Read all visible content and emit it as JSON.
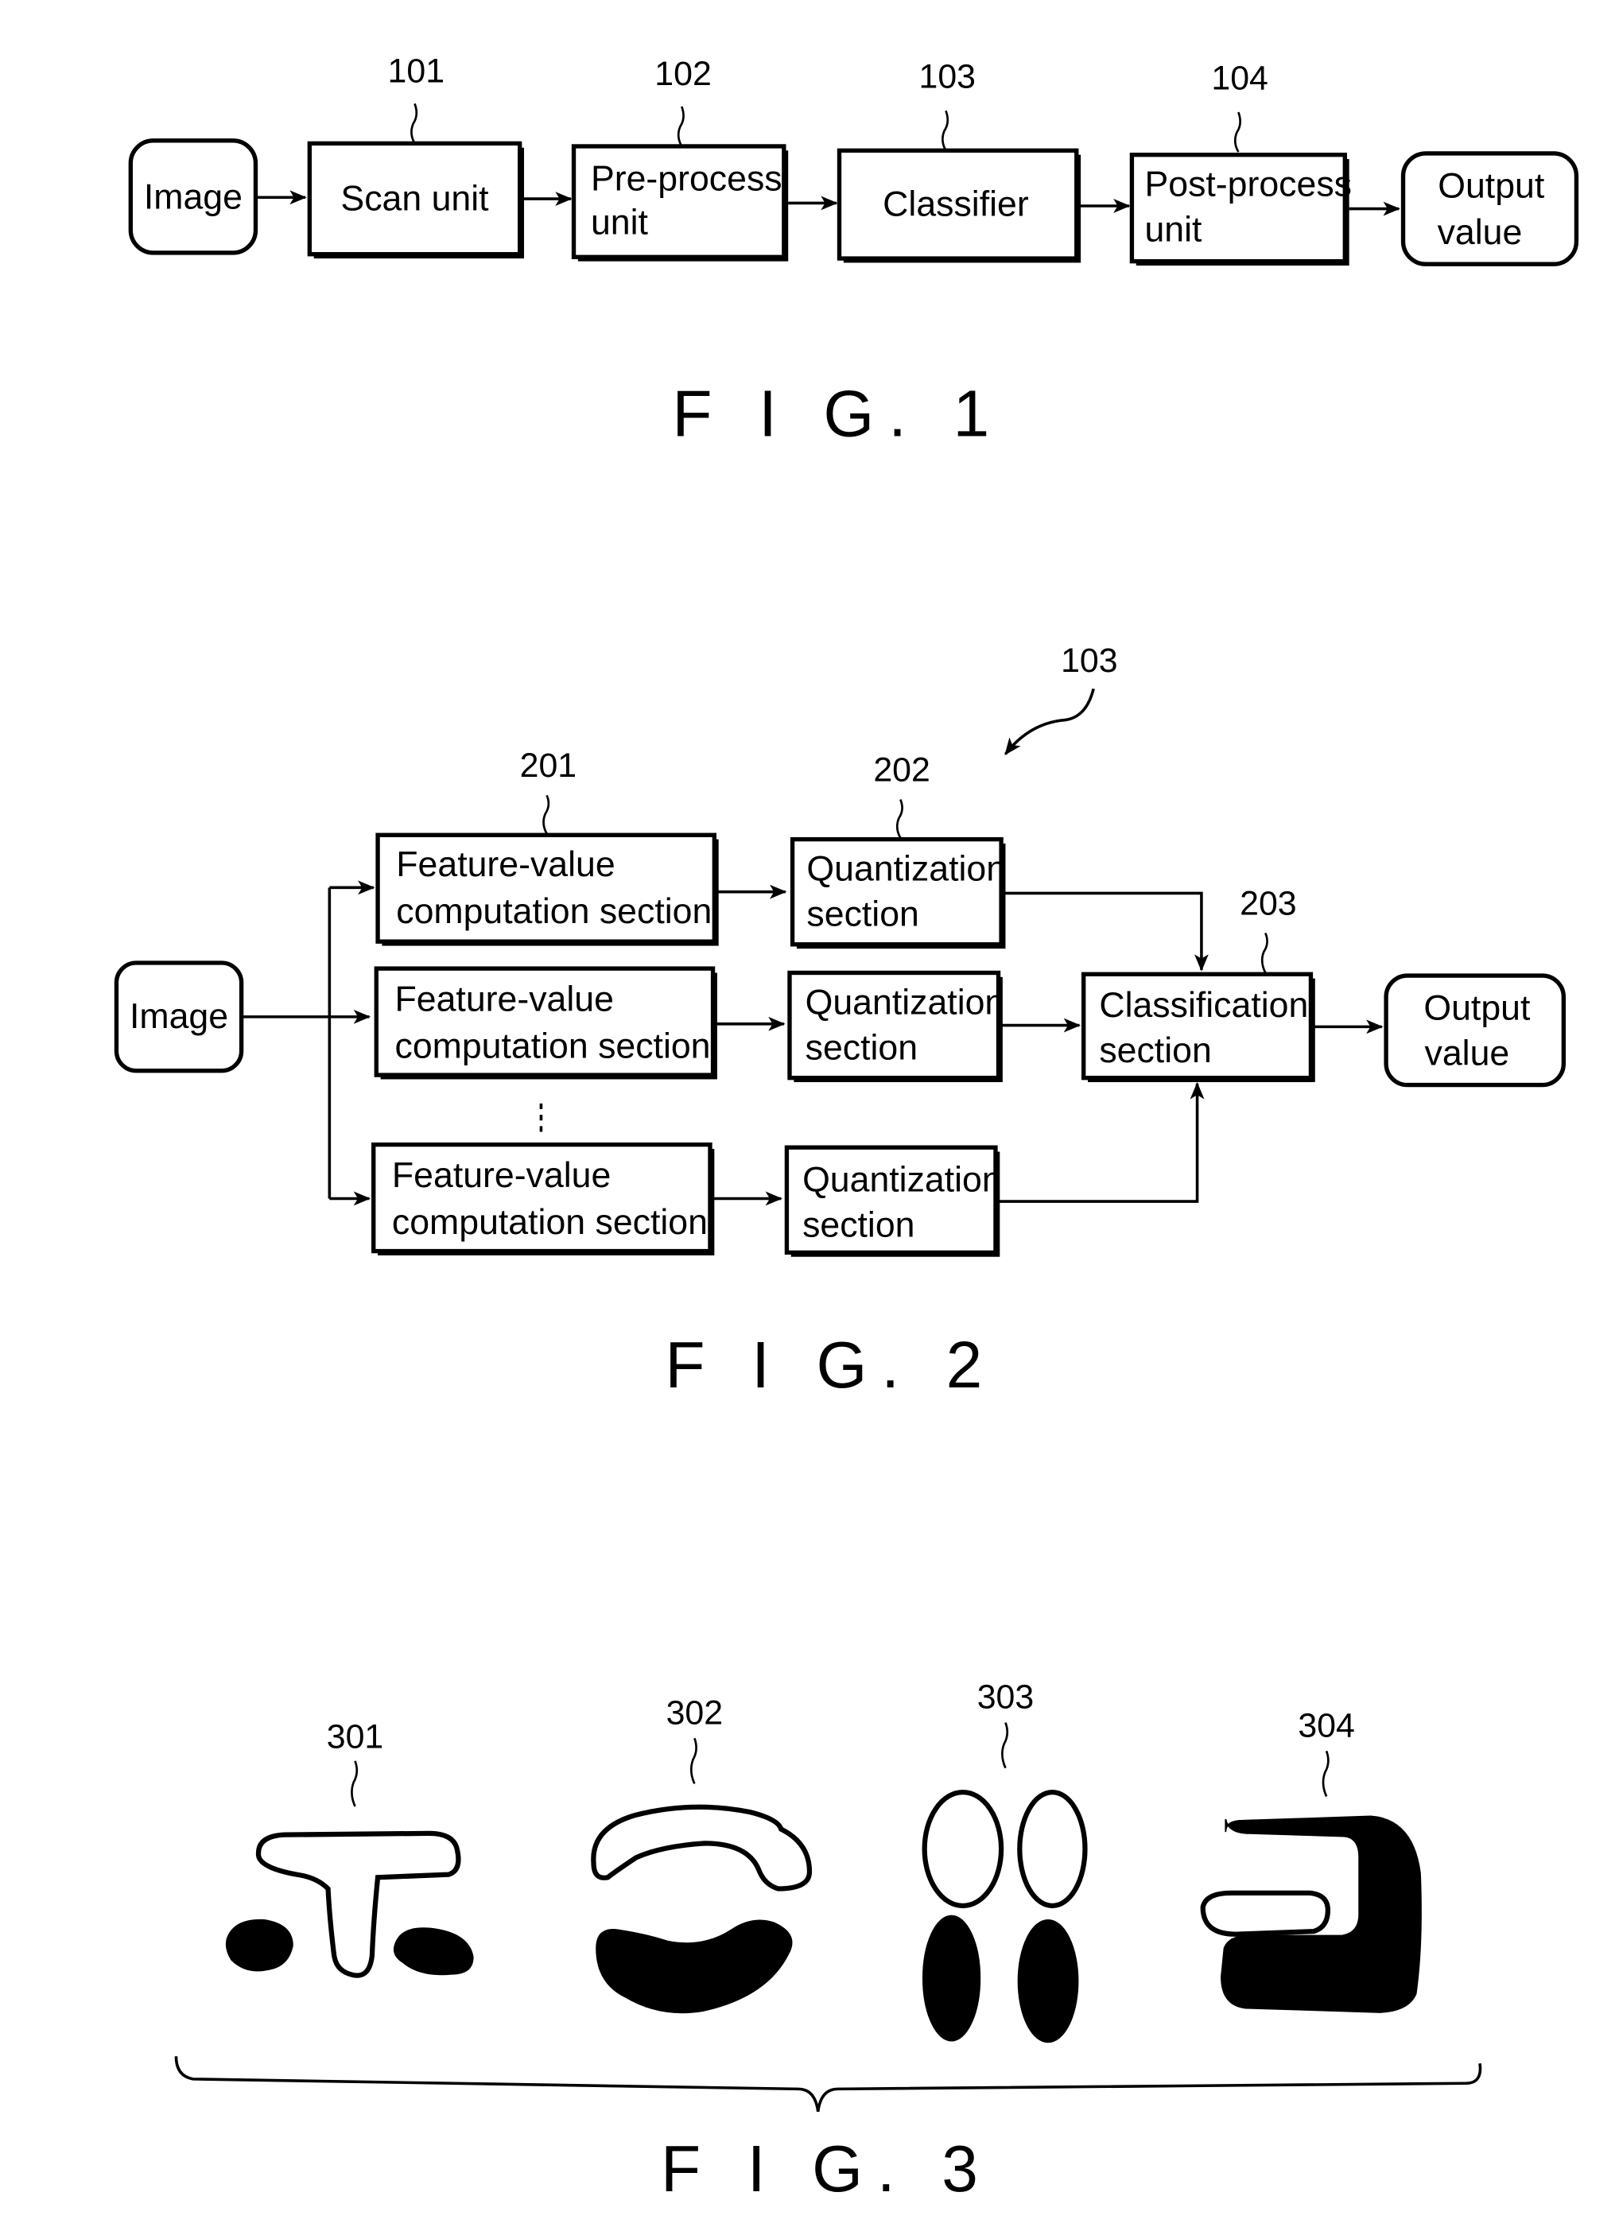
{
  "fig1": {
    "caption": "F I G. 1",
    "blocks": [
      {
        "id": "image",
        "lines": [
          "Image"
        ],
        "ref": ""
      },
      {
        "id": "scan",
        "lines": [
          "Scan  unit"
        ],
        "ref": "101"
      },
      {
        "id": "pre",
        "lines": [
          "Pre-process",
          "unit"
        ],
        "ref": "102"
      },
      {
        "id": "classifier",
        "lines": [
          "Classifier"
        ],
        "ref": "103"
      },
      {
        "id": "post",
        "lines": [
          "Post-process",
          "unit"
        ],
        "ref": "104"
      },
      {
        "id": "output",
        "lines": [
          "Output",
          "value"
        ],
        "ref": ""
      }
    ]
  },
  "fig2": {
    "caption": "F I G. 2",
    "group_ref": "103",
    "image_label": "Image",
    "feature_lines": [
      "Feature-value",
      "computation  section"
    ],
    "feature_ref": "201",
    "quant_lines": [
      "Quantization",
      "section"
    ],
    "quant_ref": "202",
    "class_lines": [
      "Classification",
      "section"
    ],
    "class_ref": "203",
    "output_lines": [
      "Output",
      "value"
    ]
  },
  "fig3": {
    "caption": "F I G. 3",
    "items": [
      {
        "ref": "301"
      },
      {
        "ref": "302"
      },
      {
        "ref": "303"
      },
      {
        "ref": "304"
      }
    ]
  }
}
